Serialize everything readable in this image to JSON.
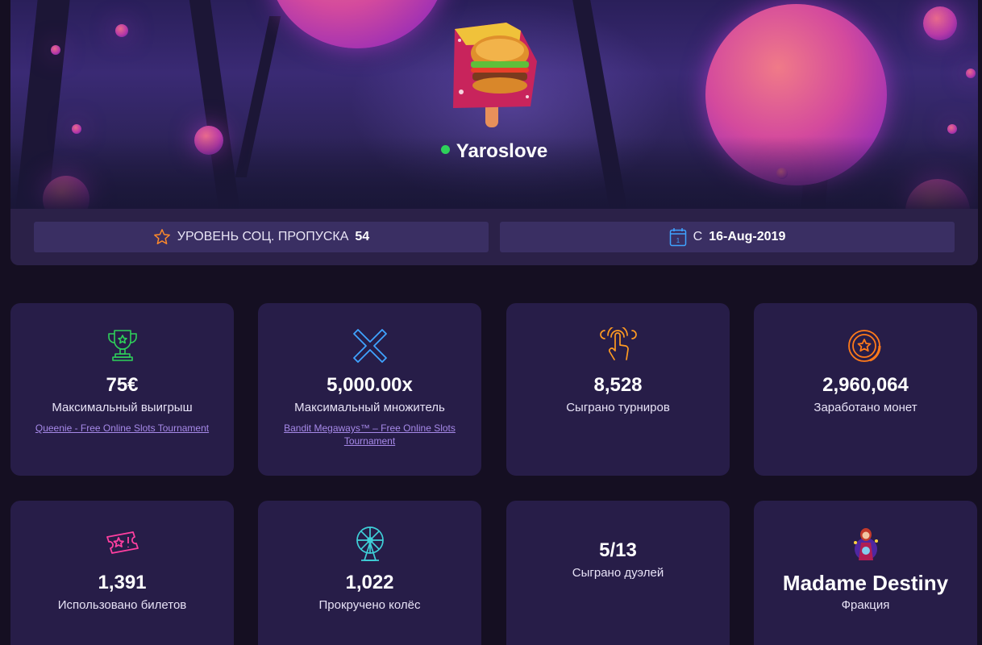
{
  "profile": {
    "username": "Yaroslove",
    "online": true,
    "battle_pass": {
      "label": "УРОВЕНЬ СОЦ. ПРОПУСКА",
      "value": "54"
    },
    "since": {
      "label": "С",
      "value": "16-Aug-2019",
      "calendar_day": "1"
    }
  },
  "stats": [
    {
      "icon": "trophy-icon",
      "value": "75€",
      "label": "Максимальный выигрыш",
      "link": "Queenie - Free Online Slots Tournament",
      "color": "#2ed15a"
    },
    {
      "icon": "multiplier-x-icon",
      "value": "5,000.00x",
      "label": "Максимальный множитель",
      "link": "Bandit Megaways™ – Free Online Slots Tournament",
      "color": "#3fa3ff"
    },
    {
      "icon": "tap-hand-icon",
      "value": "8,528",
      "label": "Сыграно турниров",
      "color": "#ff9b21"
    },
    {
      "icon": "coin-star-icon",
      "value": "2,960,064",
      "label": "Заработано монет",
      "color": "#ff7a1a"
    },
    {
      "icon": "ticket-icon",
      "value": "1,391",
      "label": "Использовано билетов",
      "color": "#ff3fa0"
    },
    {
      "icon": "ferris-wheel-icon",
      "value": "1,022",
      "label": "Прокручено колёс",
      "color": "#3fd0d8"
    },
    {
      "value": "5/13",
      "label": "Сыграно дуэлей"
    },
    {
      "icon": "faction-avatar-icon",
      "value": "Madame Destiny",
      "label": "Фракция"
    }
  ]
}
